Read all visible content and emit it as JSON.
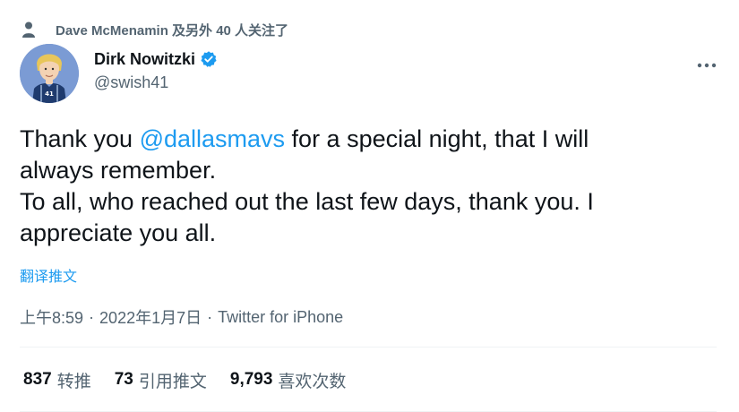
{
  "social_context": {
    "text": "Dave McMenamin 及另外 40 人关注了",
    "icon": "person-icon"
  },
  "author": {
    "display_name": "Dirk Nowitzki",
    "handle": "@swish41",
    "verified": true,
    "verified_color": "#1d9bf0",
    "avatar_description": "cartoon-avatar"
  },
  "tweet": {
    "line1_before": "Thank you ",
    "mention": "@dallasmavs",
    "line1_after": " for a special night, that I will",
    "line2": "always remember.",
    "line3": "To all, who reached out the last few days, thank you. I",
    "line4": "appreciate you all."
  },
  "translate_label": "翻译推文",
  "meta": {
    "time": "上午8:59",
    "separator": "·",
    "date": "2022年1月7日",
    "source": "Twitter for iPhone"
  },
  "stats": [
    {
      "count": "837",
      "label": "转推"
    },
    {
      "count": "73",
      "label": "引用推文"
    },
    {
      "count": "9,793",
      "label": "喜欢次数"
    }
  ],
  "colors": {
    "accent": "#1d9bf0",
    "secondary_text": "#536471",
    "primary_text": "#0f1419",
    "divider": "#eff3f4"
  }
}
